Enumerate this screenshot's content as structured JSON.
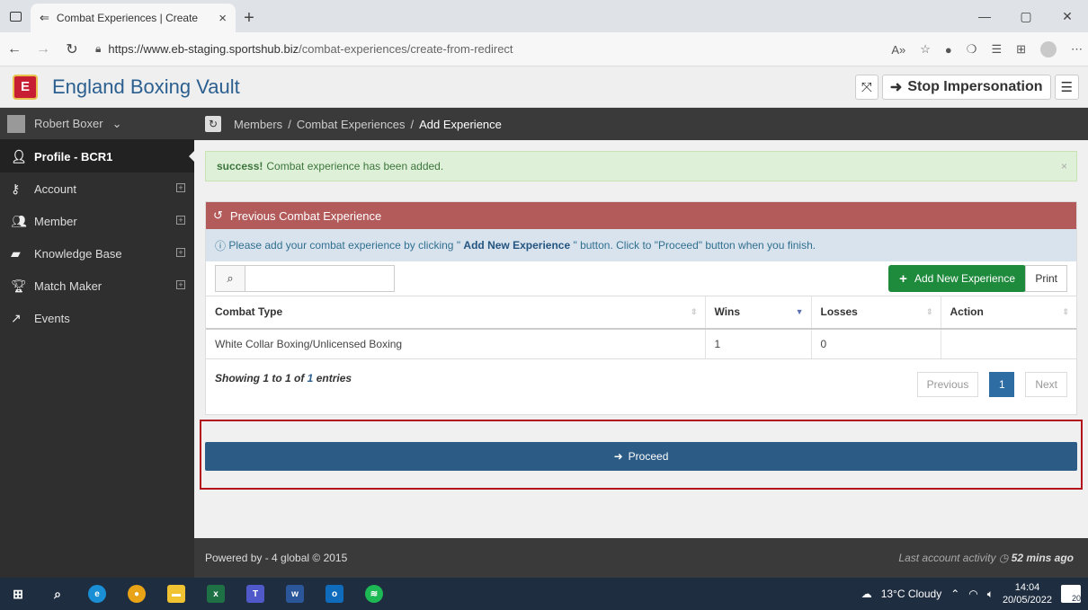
{
  "browser": {
    "tab_title": "Combat Experiences | Create",
    "url_host": "https://www.eb-staging.sportshub.biz",
    "url_path": "/combat-experiences/create-from-redirect"
  },
  "app": {
    "brand": "England Boxing Vault",
    "logo_text": "E",
    "stop_impersonation": "Stop Impersonation"
  },
  "sidebar": {
    "user_name": "Robert Boxer",
    "items": [
      {
        "label": "Profile - BCR1",
        "icon": "user-icon"
      },
      {
        "label": "Account",
        "icon": "key-icon"
      },
      {
        "label": "Member",
        "icon": "users-icon"
      },
      {
        "label": "Knowledge Base",
        "icon": "book-icon"
      },
      {
        "label": "Match Maker",
        "icon": "trophy-icon"
      },
      {
        "label": "Events",
        "icon": "external-link-icon"
      }
    ]
  },
  "breadcrumb": {
    "items": [
      "Members",
      "Combat Experiences",
      "Add Experience"
    ]
  },
  "alert": {
    "strong": "success!",
    "message": "Combat experience has been added."
  },
  "panel": {
    "title": "Previous Combat Experience",
    "info_prefix": "Please add your combat experience by clicking \"",
    "info_bold": "Add New Experience",
    "info_suffix": "\" button. Click to \"Proceed\" button when you finish.",
    "search_placeholder": "",
    "add_button": "Add New Experience",
    "print_button": "Print",
    "columns": [
      "Combat Type",
      "Wins",
      "Losses",
      "Action"
    ],
    "rows": [
      {
        "combat_type": "White Collar Boxing/Unlicensed Boxing",
        "wins": "1",
        "losses": "0",
        "action": ""
      }
    ],
    "entries_prefix": "Showing 1 to 1 of",
    "entries_total": "1",
    "entries_suffix": "entries",
    "pager": {
      "previous": "Previous",
      "current": "1",
      "next": "Next"
    }
  },
  "proceed_button": "Proceed",
  "footer": {
    "powered": "Powered by - 4 global © 2015",
    "last_activity_prefix": "Last account activity",
    "last_activity_value": "52 mins ago"
  },
  "taskbar": {
    "weather": "13°C  Cloudy",
    "time": "14:04",
    "date": "20/05/2022",
    "notifications": "20"
  }
}
